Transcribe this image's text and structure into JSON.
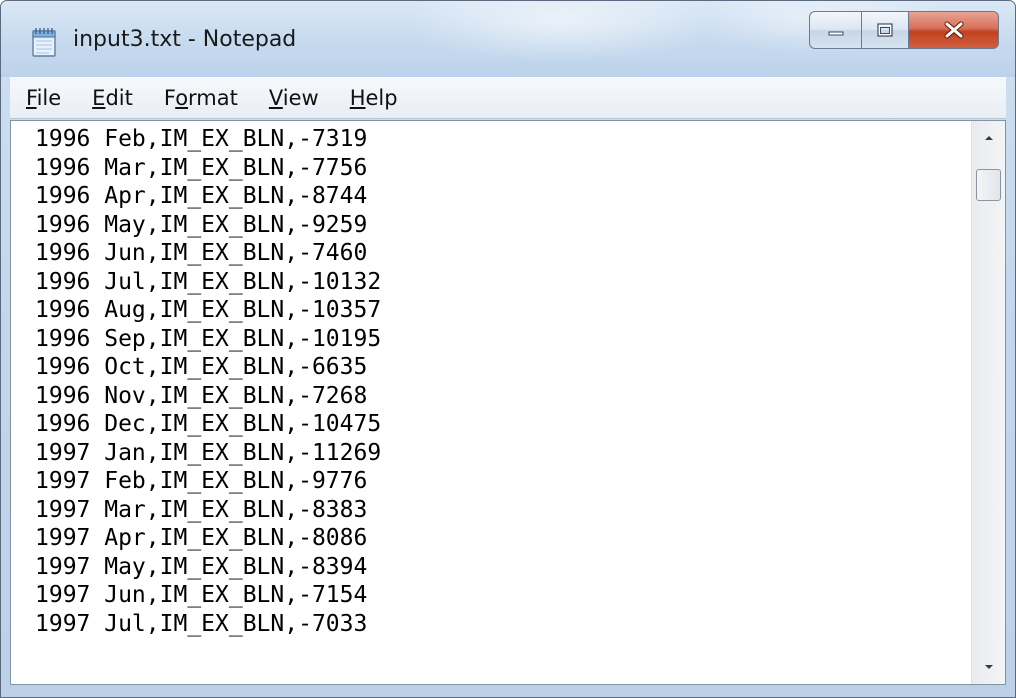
{
  "window": {
    "title": "input3.txt - Notepad",
    "close_color": "#c2401f"
  },
  "caption_buttons": [
    "minimize-icon",
    "maximize-icon",
    "close-icon"
  ],
  "menu": {
    "items": [
      {
        "mnemonic": "F",
        "rest": "ile",
        "label": "File"
      },
      {
        "mnemonic": "E",
        "rest": "dit",
        "label": "Edit"
      },
      {
        "pre": "F",
        "mnemonic": "o",
        "rest": "rmat",
        "label": "Format"
      },
      {
        "mnemonic": "V",
        "rest": "iew",
        "label": "View"
      },
      {
        "mnemonic": "H",
        "rest": "elp",
        "label": "Help"
      }
    ]
  },
  "document": {
    "lines": [
      "1996 Feb,IM_EX_BLN,-7319",
      "1996 Mar,IM_EX_BLN,-7756",
      "1996 Apr,IM_EX_BLN,-8744",
      "1996 May,IM_EX_BLN,-9259",
      "1996 Jun,IM_EX_BLN,-7460",
      "1996 Jul,IM_EX_BLN,-10132",
      "1996 Aug,IM_EX_BLN,-10357",
      "1996 Sep,IM_EX_BLN,-10195",
      "1996 Oct,IM_EX_BLN,-6635",
      "1996 Nov,IM_EX_BLN,-7268",
      "1996 Dec,IM_EX_BLN,-10475",
      "1997 Jan,IM_EX_BLN,-11269",
      "1997 Feb,IM_EX_BLN,-9776",
      "1997 Mar,IM_EX_BLN,-8383",
      "1997 Apr,IM_EX_BLN,-8086",
      "1997 May,IM_EX_BLN,-8394",
      "1997 Jun,IM_EX_BLN,-7154",
      "1997 Jul,IM_EX_BLN,-7033"
    ]
  },
  "scrollbar": {
    "up_icon": "scroll-up-arrow-icon",
    "down_icon": "scroll-down-arrow-icon"
  }
}
